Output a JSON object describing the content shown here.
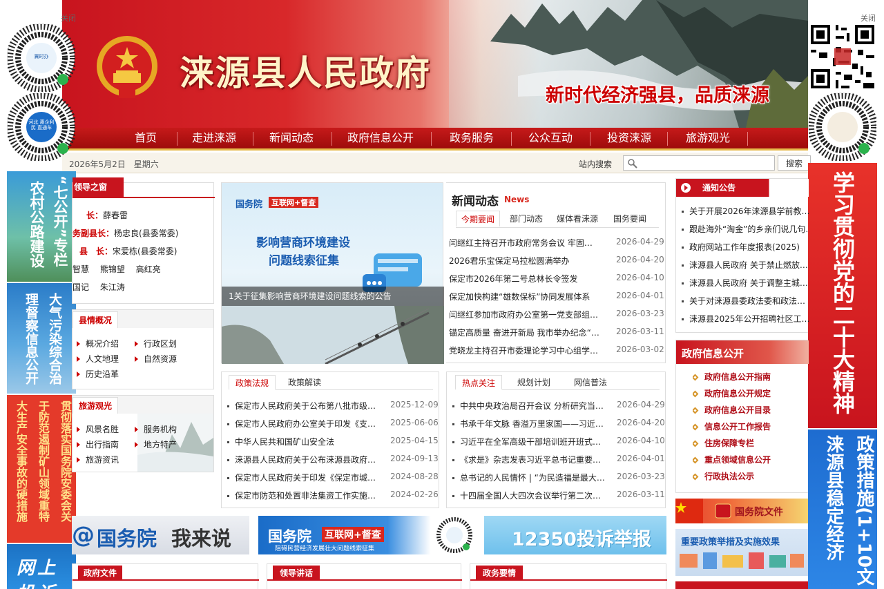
{
  "header": {
    "title": "涞源县人民政府",
    "slogan": "新时代经济强县，品质涞源"
  },
  "nav": [
    "首页",
    "走进涞源",
    "新闻动态",
    "政府信息公开",
    "政务服务",
    "公众互动",
    "投资涞源",
    "旅游观光"
  ],
  "infobar": {
    "date": "2026年5月2日　星期六",
    "search_label": "站内搜索",
    "search_placeholder": "",
    "search_button": "搜索"
  },
  "floats": {
    "close_left": "关闭",
    "close_right": "关闭",
    "qr_left_1": "冀时办",
    "qr_left_2": "河北 惠企利民 直通车",
    "banner_left_1": "农村公路建设“七公开”专栏",
    "banner_left_1_a": "农村公路建设",
    "banner_left_1_b": "“七公开”专栏",
    "banner_left_2_a": "大气污染综合治",
    "banner_left_2_b": "理督察信息公开",
    "banner_left_3_a": "贯彻落实国务院安委会关",
    "banner_left_3_b": "于防范遏制矿山领域重特",
    "banner_left_3_c": "大生产安全事故的硬措施",
    "banner_left_4": "网上投诉",
    "banner_right_1": "学习贯彻党的二十大精神",
    "banner_right_2_a": "政策措施(1+10文",
    "banner_right_2_b": "涞源县稳定经济"
  },
  "leaders": {
    "title": "领导之窗",
    "rows": [
      {
        "role": "长：",
        "name": "薛春雷"
      },
      {
        "role": "务副县长：",
        "name": "杨忠良(县委常委)"
      },
      {
        "role": "县　长：",
        "name": "宋爱栋(县委常委)"
      },
      {
        "role": "",
        "name": "智慧　 熊锦望　 高红亮"
      },
      {
        "role": "",
        "name": "国记　 朱江涛"
      }
    ]
  },
  "county": {
    "title": "县情概况",
    "links": [
      "概况介绍",
      "行政区划",
      "人文地理",
      "自然资源",
      "历史沿革"
    ]
  },
  "tourism": {
    "title": "旅游观光",
    "links": [
      "风景名胜",
      "服务机构",
      "出行指南",
      "地方特产",
      "旅游资讯"
    ]
  },
  "carousel": {
    "banner_small": "国务院",
    "banner_badge": "互联网+督查",
    "headline_1": "影响营商环境建设",
    "headline_2": "问题线索征集",
    "caption": "1关于征集影响营商环境建设问题线索的公告"
  },
  "news": {
    "title": "新闻动态",
    "title_en": "News",
    "tabs": [
      "今期要闻",
      "部门动态",
      "媒体看涞源",
      "国务要闻"
    ],
    "items": [
      {
        "t": "闫继红主持召开市政府常务会议 牢固…",
        "d": "2026-04-29"
      },
      {
        "t": "2026君乐宝保定马拉松圆满举办",
        "d": "2026-04-20"
      },
      {
        "t": "保定市2026年第二号总林长令签发",
        "d": "2026-04-10"
      },
      {
        "t": "保定加快构建“雄数保标”协同发展体系",
        "d": "2026-04-01"
      },
      {
        "t": "闫继红参加市政府办公室第一党支部组…",
        "d": "2026-03-23"
      },
      {
        "t": "锚定高质量 奋进开新局 我市举办纪念“…",
        "d": "2026-03-11"
      },
      {
        "t": "党晓龙主持召开市委理论学习中心组学…",
        "d": "2026-03-02"
      }
    ]
  },
  "policy": {
    "tabs": [
      "政策法规",
      "政策解读"
    ],
    "items": [
      {
        "t": "保定市人民政府关于公布第八批市级…",
        "d": "2025-12-09"
      },
      {
        "t": "保定市人民政府办公室关于印发《支…",
        "d": "2025-06-06"
      },
      {
        "t": "中华人民共和国矿山安全法",
        "d": "2025-04-15"
      },
      {
        "t": "涞源县人民政府关于公布涞源县政府…",
        "d": "2024-09-13"
      },
      {
        "t": "保定市人民政府关于印发《保定市城…",
        "d": "2024-08-28"
      },
      {
        "t": "保定市防范和处置非法集资工作实施…",
        "d": "2024-02-26"
      }
    ]
  },
  "hot": {
    "tabs": [
      "热点关注",
      "规划计划",
      "网信普法"
    ],
    "items": [
      {
        "t": "中共中央政治局召开会议 分析研究当…",
        "d": "2026-04-29"
      },
      {
        "t": "书承千年文脉 香溢万里家国——习近…",
        "d": "2026-04-20"
      },
      {
        "t": "习近平在全军高级干部培训班开班式…",
        "d": "2026-04-10"
      },
      {
        "t": "《求是》杂志发表习近平总书记重要…",
        "d": "2026-04-01"
      },
      {
        "t": "总书记的人民情怀 | “为民造福是最大…",
        "d": "2026-03-23"
      },
      {
        "t": "十四届全国人大四次会议举行第二次…",
        "d": "2026-03-11"
      }
    ]
  },
  "notice": {
    "title": "通知公告",
    "items": [
      "关于开展2026年涞源县学前教…",
      "跟赴海外“淘金”的乡亲们说几句…",
      "政府网站工作年度报表(2025)",
      "涞源县人民政府 关于禁止燃放…",
      "涞源县人民政府 关于调整主城…",
      "关于对涞源县委政法委和政法…",
      "涞源县2025年公开招聘社区工…"
    ]
  },
  "gov_info": {
    "title": "政府信息公开",
    "items": [
      "政府信息公开指南",
      "政府信息公开规定",
      "政府信息公开目录",
      "信息公开工作报告",
      "住房保障专栏",
      "重点领域信息公开",
      "行政执法公示"
    ]
  },
  "promo": {
    "gov_docs": "国务院文件",
    "policy_banner": "重要政策举措及实施效果",
    "b1_at": "@",
    "b1_main": "国务院",
    "b1_sub": "我来说",
    "b2_main": "国务院",
    "b2_badge": "互联网+督查",
    "b2_sub": "阻碍民营经济发展壮大问题线索征集",
    "b3": "12350投诉举报"
  },
  "bottom": {
    "t1": "政府文件",
    "t2": "领导讲话",
    "t3": "政务要情"
  },
  "colors": {
    "brand_red": "#c8141e",
    "gold": "#e6b94a",
    "link": "#222"
  }
}
